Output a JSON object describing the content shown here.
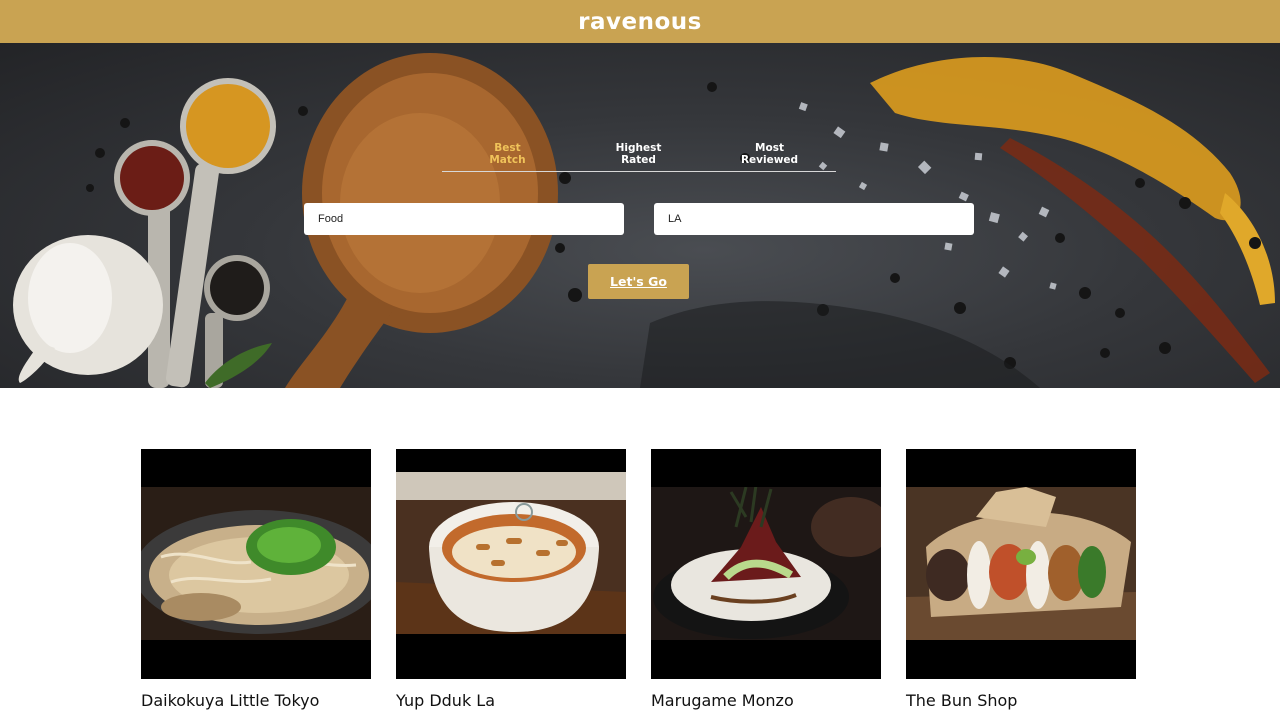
{
  "app": {
    "logo": "ravenous"
  },
  "colors": {
    "brand": "#c9a352",
    "active_tab": "#f0c35a"
  },
  "search": {
    "sort_options": [
      {
        "label": "Best\nMatch",
        "active": true
      },
      {
        "label": "Highest\nRated",
        "active": false
      },
      {
        "label": "Most\nReviewed",
        "active": false
      }
    ],
    "term_value": "Food",
    "location_value": "LA",
    "submit_label": "Let's Go"
  },
  "businesses": [
    {
      "name": "Daikokuya Little Tokyo",
      "photo_icon": "ramen-photo"
    },
    {
      "name": "Yup Dduk La",
      "photo_icon": "tteokbokki-bowl-photo"
    },
    {
      "name": "Marugame Monzo",
      "photo_icon": "rice-bowl-photo"
    },
    {
      "name": "The Bun Shop",
      "photo_icon": "bao-buns-photo"
    }
  ]
}
